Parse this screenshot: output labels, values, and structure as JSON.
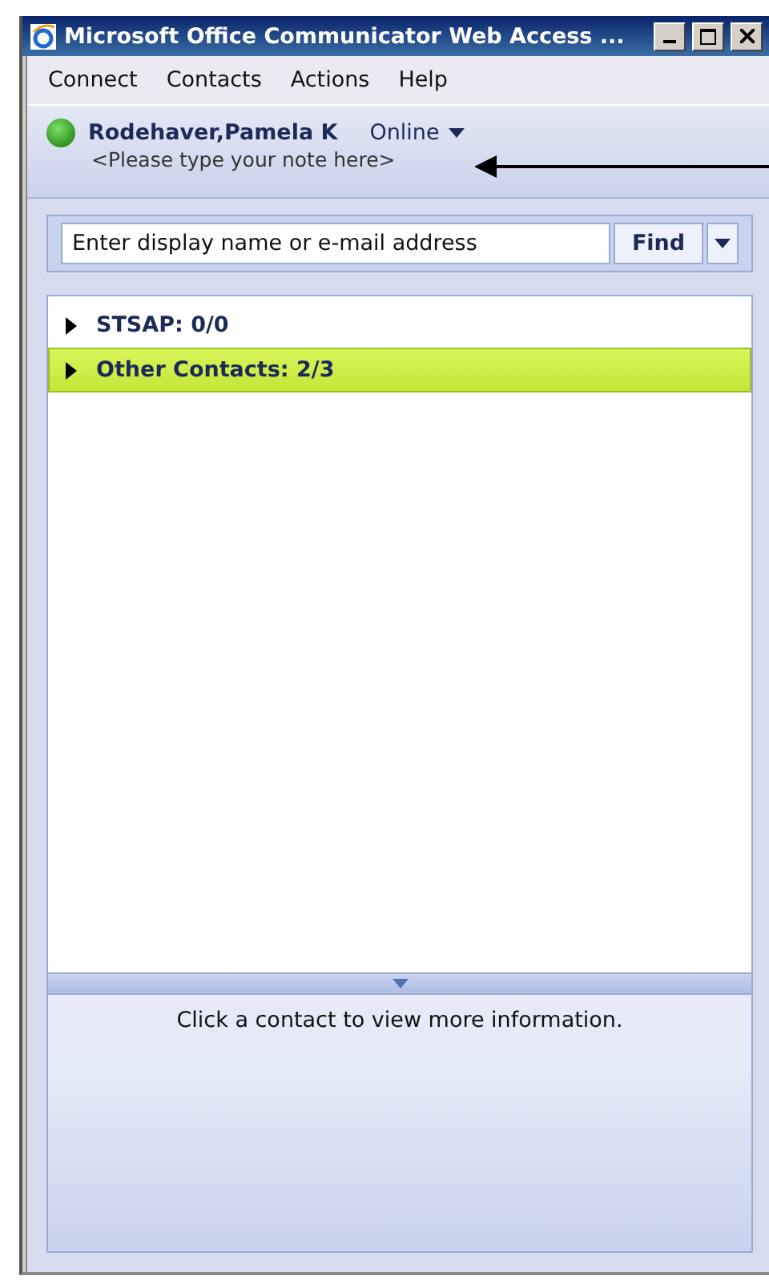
{
  "window": {
    "title": "Microsoft Office Communicator Web Access ..."
  },
  "menu": [
    "Connect",
    "Contacts",
    "Actions",
    "Help"
  ],
  "user": {
    "name": "Rodehaver,Pamela K",
    "status": "Online",
    "note": "<Please type your note here>"
  },
  "search": {
    "placeholder": "Enter display name or e-mail address",
    "button": "Find"
  },
  "groups": [
    {
      "label": "STSAP: 0/0",
      "selected": false,
      "expanded": false
    },
    {
      "label": "Other Contacts: 2/3",
      "selected": true,
      "expanded": false
    }
  ],
  "info": "Click a contact to view more information."
}
